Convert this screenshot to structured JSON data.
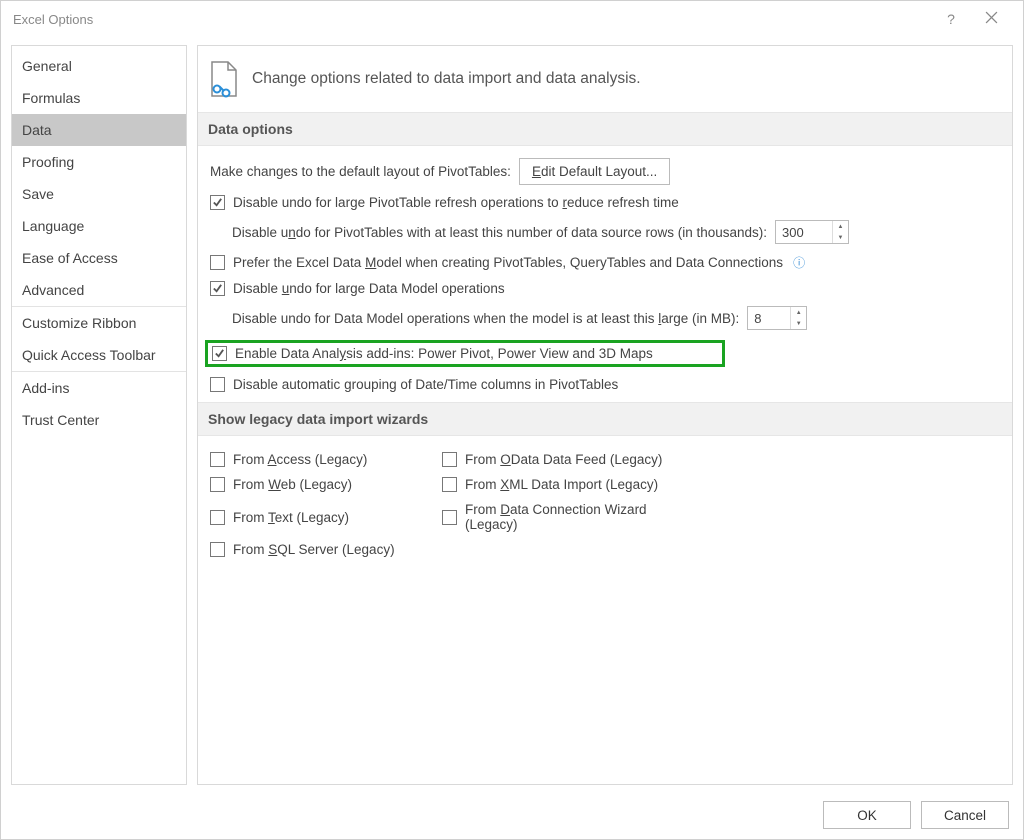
{
  "window": {
    "title": "Excel Options"
  },
  "sidebar": {
    "items": [
      {
        "label": "General"
      },
      {
        "label": "Formulas"
      },
      {
        "label": "Data",
        "selected": true
      },
      {
        "label": "Proofing"
      },
      {
        "label": "Save"
      },
      {
        "label": "Language"
      },
      {
        "label": "Ease of Access"
      },
      {
        "label": "Advanced"
      },
      {
        "label": "Customize Ribbon"
      },
      {
        "label": "Quick Access Toolbar"
      },
      {
        "label": "Add-ins"
      },
      {
        "label": "Trust Center"
      }
    ]
  },
  "header": {
    "text": "Change options related to data import and data analysis."
  },
  "dataOptions": {
    "title": "Data options",
    "pivotLayout": {
      "label_pre": "Make changes to the default layout of PivotTables:",
      "button_pre": "E",
      "button_mid": "dit Default Layout..."
    },
    "opt1": {
      "checked": true,
      "pre": "Disable undo for large PivotTable refresh operations to ",
      "u": "r",
      "post": "educe refresh time"
    },
    "opt2": {
      "label_pre": "Disable u",
      "label_u": "n",
      "label_post": "do for PivotTables with at least this number of data source rows (in thousands):",
      "value": "300"
    },
    "opt3": {
      "checked": false,
      "pre": "Prefer the Excel Data ",
      "u": "M",
      "post": "odel when creating PivotTables, QueryTables and Data Connections"
    },
    "opt4": {
      "checked": true,
      "pre": "Disable ",
      "u": "u",
      "post": "ndo for large Data Model operations"
    },
    "opt5": {
      "label_pre": "Disable undo for Data Model operations when the model is at least this ",
      "label_u": "l",
      "label_post": "arge (in MB):",
      "value": "8"
    },
    "opt6": {
      "checked": true,
      "pre": "Enable Data Anal",
      "u": "y",
      "post": "sis add-ins: Power Pivot, Power View and 3D Maps"
    },
    "opt7": {
      "checked": false,
      "pre": "Disable automatic ",
      "u": "g",
      "post": "rouping of Date/Time columns in PivotTables"
    }
  },
  "legacy": {
    "title": "Show legacy data import wizards",
    "items": [
      {
        "checked": false,
        "pre": "From ",
        "u": "A",
        "post": "ccess (Legacy)"
      },
      {
        "checked": false,
        "pre": "From ",
        "u": "O",
        "post": "Data Data Feed (Legacy)"
      },
      {
        "checked": false,
        "pre": "From ",
        "u": "W",
        "post": "eb (Legacy)"
      },
      {
        "checked": false,
        "pre": "From ",
        "u": "X",
        "post": "ML Data Import (Legacy)"
      },
      {
        "checked": false,
        "pre": "From ",
        "u": "T",
        "post": "ext (Legacy)"
      },
      {
        "checked": false,
        "pre": "From ",
        "u": "D",
        "post": "ata Connection Wizard (Legacy)"
      },
      {
        "checked": false,
        "pre": "From ",
        "u": "S",
        "post": "QL Server (Legacy)"
      }
    ]
  },
  "footer": {
    "ok": "OK",
    "cancel": "Cancel"
  }
}
